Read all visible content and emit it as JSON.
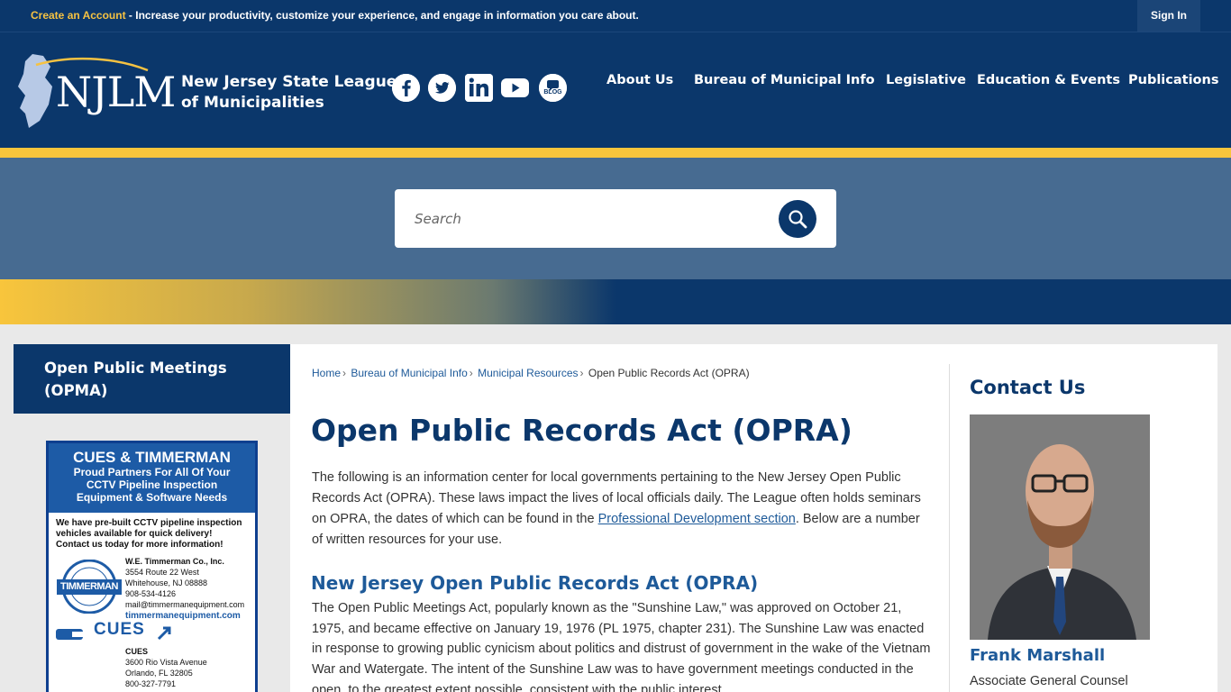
{
  "topbar": {
    "create_account": "Create an Account",
    "promo_text": " - Increase your productivity, customize your experience, and engage in information you care about.",
    "sign_in": "Sign In"
  },
  "header": {
    "logo_text": "NJLM",
    "org_line1": "New Jersey State League",
    "org_line2": "of Municipalities",
    "social": [
      "facebook-icon",
      "twitter-icon",
      "linkedin-icon",
      "youtube-icon",
      "blog-icon"
    ],
    "blog_label": "BLOG",
    "nav": [
      "About Us",
      "Bureau of Municipal Info",
      "Legislative",
      "Education & Events",
      "Publications"
    ]
  },
  "search": {
    "placeholder": "Search"
  },
  "sidebar": {
    "title": "Open Public Meetings (OPMA)",
    "ad": {
      "headline": "CUES & TIMMERMAN",
      "tagline_1": "Proud Partners For All Of Your",
      "tagline_2": "CCTV Pipeline Inspection",
      "tagline_3": "Equipment & Software Needs",
      "body": "We have pre-built CCTV pipeline inspection vehicles available for quick delivery! Contact us today for more information!",
      "badge_text": "TIMMERMAN",
      "company_1": "W.E. Timmerman Co., Inc.",
      "addr_1a": "3554 Route 22 West",
      "addr_1b": "Whitehouse, NJ 08888",
      "phone_1": "908-534-4126",
      "email_1": "mail@timmermanequipment.com",
      "web_1": "timmermanequipment.com",
      "cues_logo": "CUES",
      "company_2": "CUES",
      "addr_2a": "3600 Rio Vista Avenue",
      "addr_2b": "Orlando, FL 32805",
      "phone_2": "800-327-7791"
    }
  },
  "breadcrumb": [
    "Home",
    "Bureau of Municipal Info",
    "Municipal Resources",
    "Open Public Records Act (OPRA)"
  ],
  "main": {
    "title": "Open Public Records Act (OPRA)",
    "intro_before": "The following is an information center for local governments pertaining to the New Jersey Open Public Records Act (OPRA). These laws impact the lives of local officials daily. The League often holds seminars on OPRA, the dates of which can be found in the ",
    "intro_link": "Professional Development section",
    "intro_after": ". Below are a number of written resources for your use.",
    "subtitle": "New Jersey Open Public Records Act (OPRA)",
    "body": "The Open Public Meetings Act, popularly known as the \"Sunshine Law,\" was approved on October 21, 1975, and became effective on January 19, 1976 (PL 1975, chapter 231). The Sunshine Law was enacted in response to growing public cynicism about politics and distrust of government in the wake of the Vietnam War and Watergate. The intent of the Sunshine Law was to have government meetings conducted in the open, to the greatest extent possible, consistent with the public interest."
  },
  "contact": {
    "title": "Contact Us",
    "name": "Frank Marshall",
    "role": "Associate General Counsel"
  }
}
